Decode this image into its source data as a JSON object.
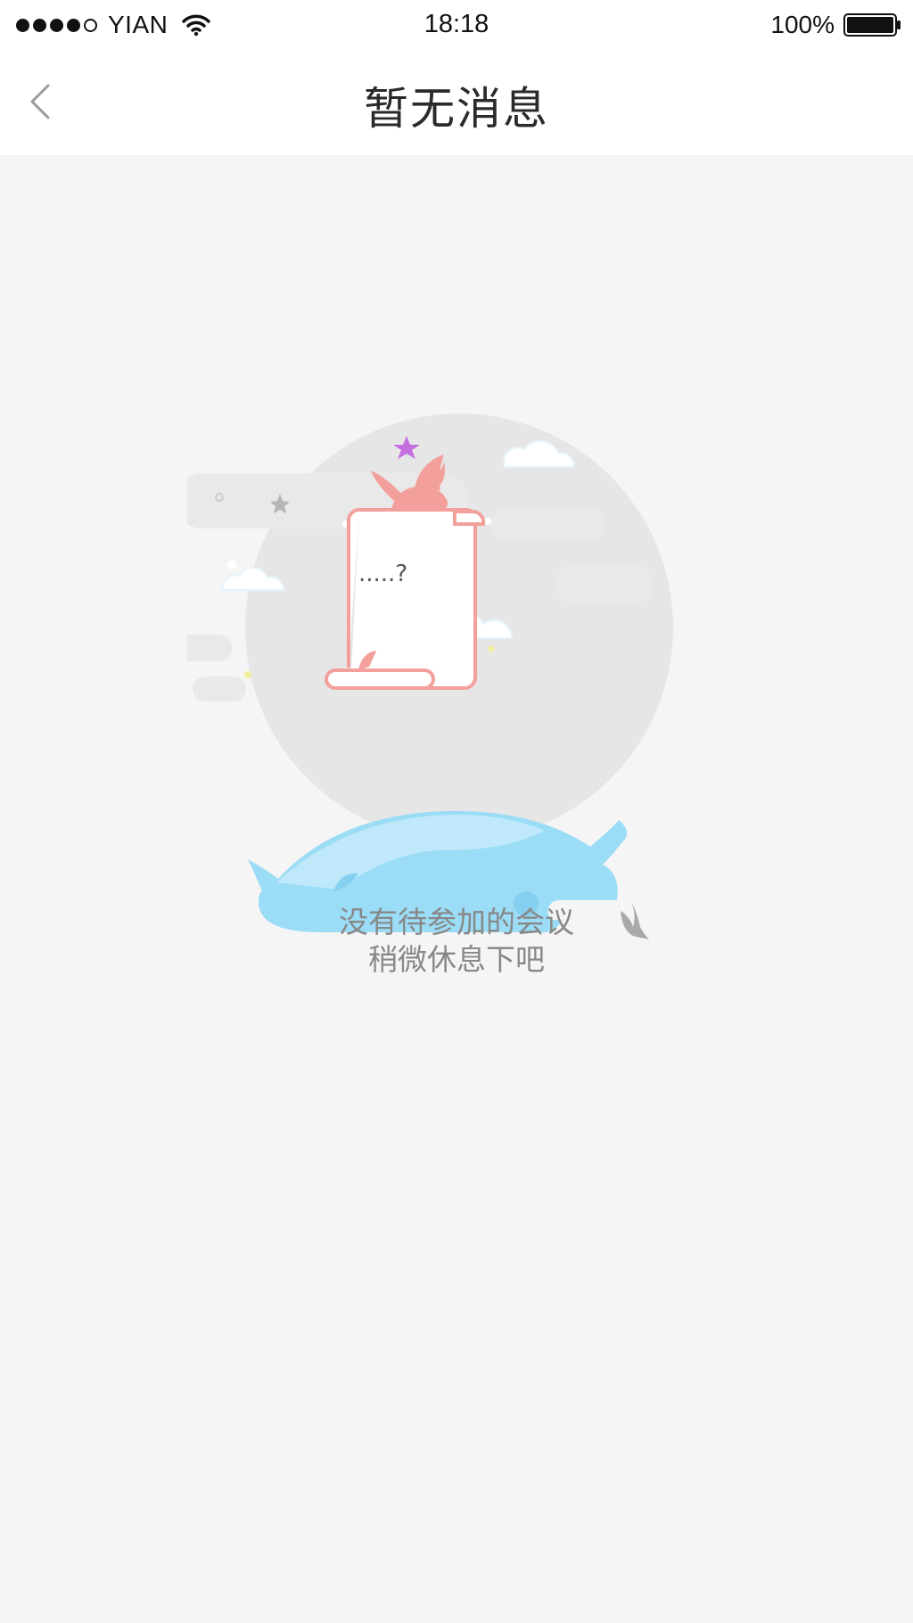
{
  "status_bar": {
    "carrier": "YIAN",
    "time": "18:18",
    "battery": "100%",
    "icons": {
      "signal": "signal-strength-icon",
      "wifi": "wifi-icon",
      "battery": "battery-icon"
    }
  },
  "nav": {
    "title": "暂无消息",
    "back_icon": "chevron-left-icon"
  },
  "empty_state": {
    "illustration": "empty-meetings-illustration",
    "scroll_text": ".....?",
    "line1": "没有待参加的会议",
    "line2": "稍微休息下吧"
  },
  "colors": {
    "background": "#f5f5f5",
    "header": "#ffffff",
    "bird": "#f3a09c",
    "whale": "#9bdcf6",
    "text_muted": "#888888"
  }
}
